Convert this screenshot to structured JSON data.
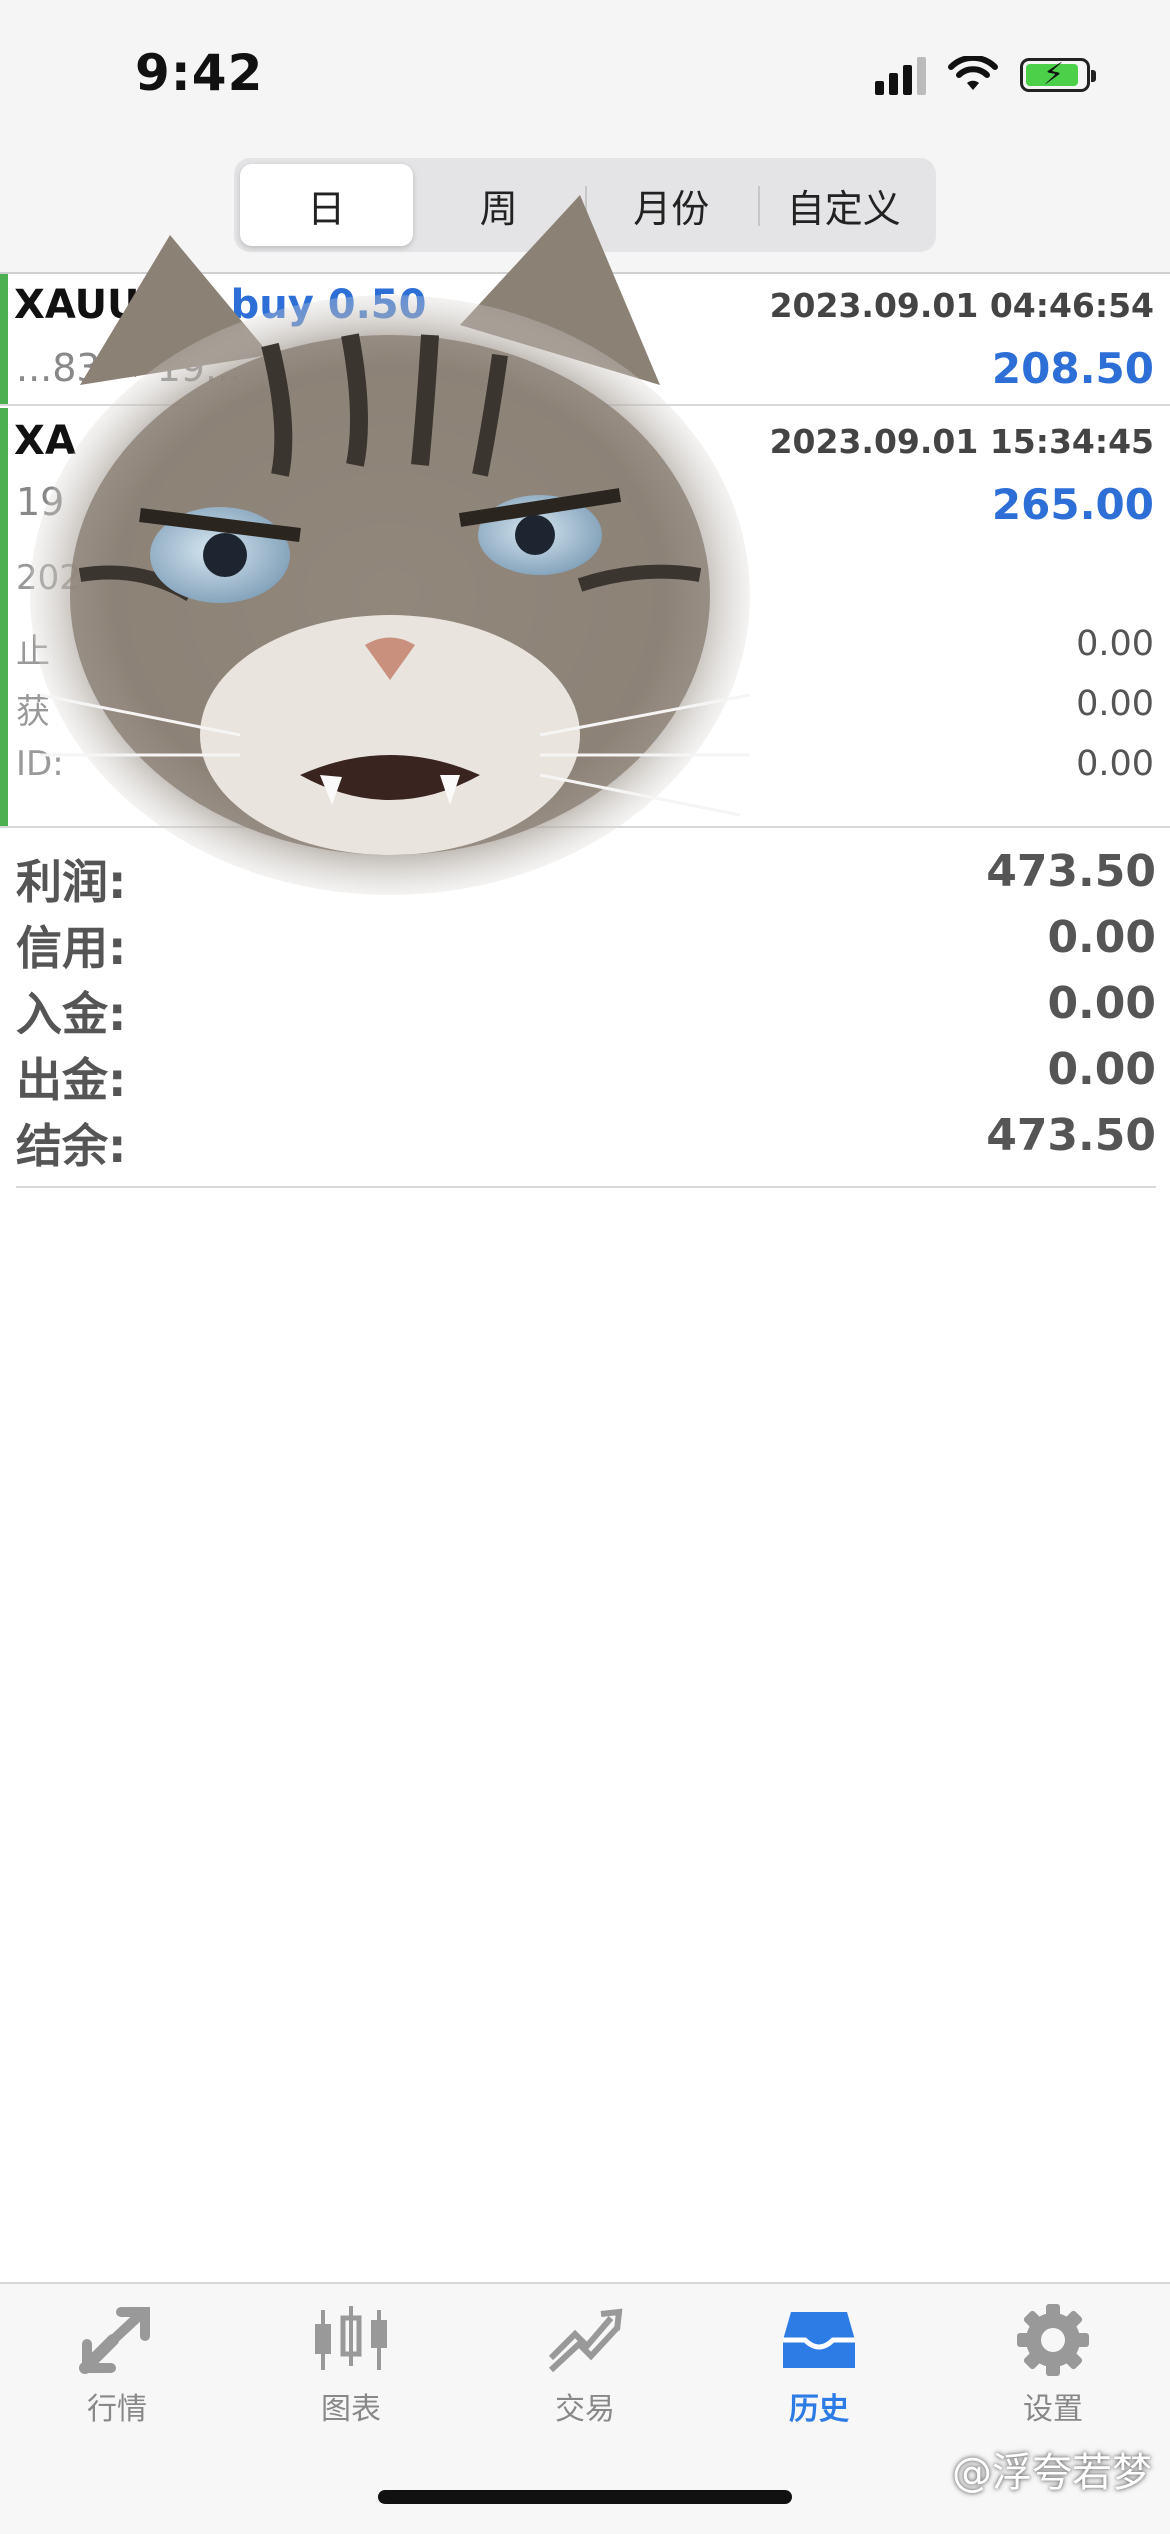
{
  "status_bar": {
    "time": "9:42"
  },
  "period_tabs": [
    {
      "label": "日",
      "active": true
    },
    {
      "label": "周",
      "active": false
    },
    {
      "label": "月份",
      "active": false
    },
    {
      "label": "自定义",
      "active": false
    }
  ],
  "trades": [
    {
      "symbol": "XAUUSD,",
      "side": "buy 0.50",
      "datetime": "2023.09.01 04:46:54",
      "price_range": "...83 → 19...",
      "profit": "208.50"
    },
    {
      "symbol": "XA",
      "datetime": "2023.09.01 15:34:45",
      "price_range": "19",
      "profit": "265.00",
      "open_date": "202",
      "details": [
        {
          "label": "止",
          "value": "0.00"
        },
        {
          "label": "获",
          "value": "0.00"
        },
        {
          "label": "ID:",
          "value": "0.00"
        }
      ]
    }
  ],
  "summary": [
    {
      "label": "利润:",
      "value": "473.50"
    },
    {
      "label": "信用:",
      "value": "0.00"
    },
    {
      "label": "入金:",
      "value": "0.00"
    },
    {
      "label": "出金:",
      "value": "0.00"
    },
    {
      "label": "结余:",
      "value": "473.50"
    }
  ],
  "tab_bar": [
    {
      "label": "行情",
      "icon": "quotes-icon",
      "active": false
    },
    {
      "label": "图表",
      "icon": "candlestick-chart-icon",
      "active": false
    },
    {
      "label": "交易",
      "icon": "trade-icon",
      "active": false
    },
    {
      "label": "历史",
      "icon": "history-inbox-icon",
      "active": true
    },
    {
      "label": "设置",
      "icon": "gear-icon",
      "active": false
    }
  ],
  "watermark": "@浮夸若梦",
  "colors": {
    "accent": "#2d7be5",
    "profit_blue": "#2d6fd6",
    "buy_bar": "#4caf50"
  }
}
